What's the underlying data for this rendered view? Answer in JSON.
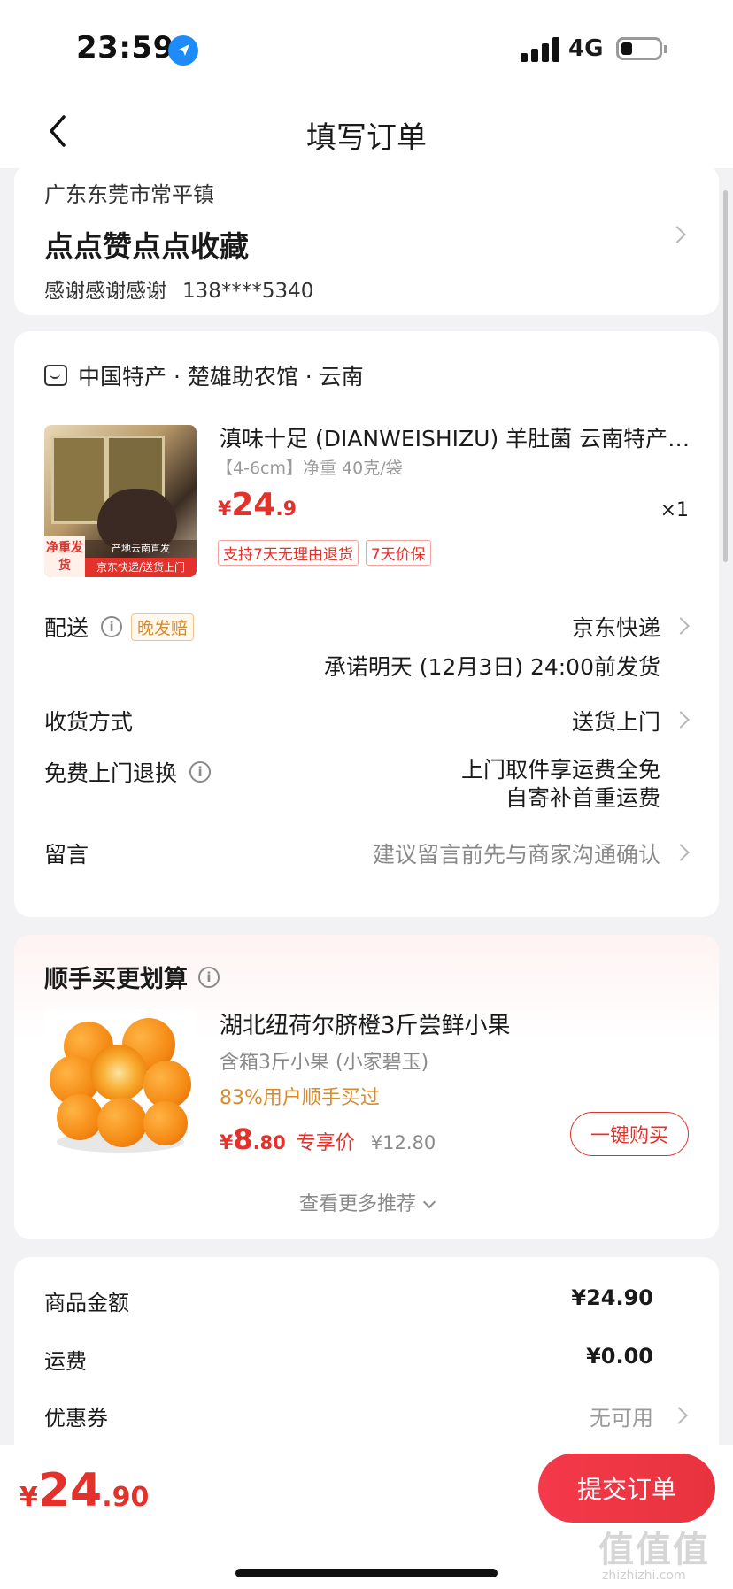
{
  "status": {
    "time": "23:59",
    "network": "4G"
  },
  "nav": {
    "title": "填写订单"
  },
  "address": {
    "region": "广东东莞市常平镇",
    "detail": "点点赞点点收藏",
    "name": "感谢感谢感谢",
    "phone": "138****5340"
  },
  "order": {
    "store": "中国特产 · 楚雄助农馆 · 云南",
    "product": {
      "title": "滇味十足 (DIANWEISHIZU) 羊肚菌 云南特产羊肚菌",
      "spec": "【4-6cm】净重 40克/袋",
      "price_currency": "¥",
      "price_int": "24",
      "price_dec": ".9",
      "qty": "×1",
      "tags": [
        "支持7天无理由退货",
        "7天价保"
      ],
      "image_labels": {
        "badge": "净重发货",
        "origin": "产地云南直发",
        "ship": "京东快递/送货上门"
      }
    },
    "delivery": {
      "label": "配送",
      "badge": "晚发赔",
      "carrier": "京东快递",
      "promise": "承诺明天 (12月3日) 24:00前发货"
    },
    "receive": {
      "label": "收货方式",
      "value": "送货上门"
    },
    "returns": {
      "label": "免费上门退换",
      "line1": "上门取件享运费全免",
      "line2": "自寄补首重运费"
    },
    "note": {
      "label": "留言",
      "placeholder": "建议留言前先与商家沟通确认"
    }
  },
  "recommend": {
    "title": "顺手买更划算",
    "product_name": "湖北纽荷尔脐橙3斤尝鲜小果",
    "spec": "含箱3斤小果 (小家碧玉)",
    "rate": "83%用户顺手买过",
    "price_currency": "¥",
    "price_int": "8",
    "price_dec": ".80",
    "price_tag": "专享价",
    "original_price": "¥12.80",
    "buy_label": "一键购买",
    "more_label": "查看更多推荐"
  },
  "summary": {
    "goods_label": "商品金额",
    "goods_value": "¥24.90",
    "shipping_label": "运费",
    "shipping_value": "¥0.00",
    "coupon_label": "优惠券",
    "coupon_value": "无可用"
  },
  "bottom": {
    "total_currency": "¥",
    "total_int": "24",
    "total_dec": ".90",
    "submit_label": "提交订单",
    "watermark": "值值值",
    "watermark_site": "zhizhizhi.com"
  },
  "colors": {
    "accent": "#e3312b",
    "orange_text": "#d98b2b",
    "background": "#f2f2f4"
  }
}
